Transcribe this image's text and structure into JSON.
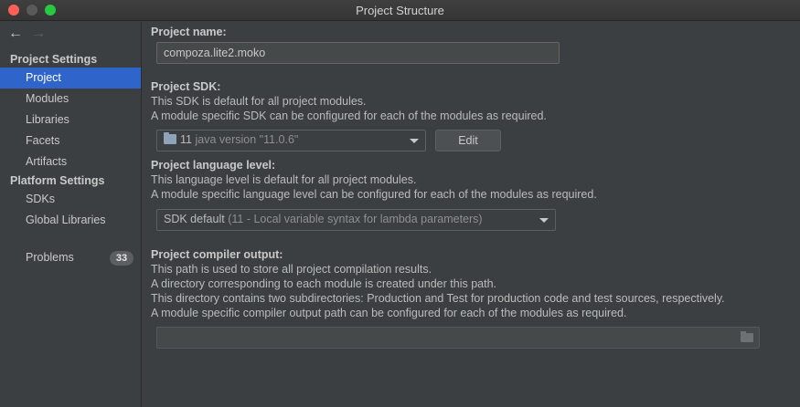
{
  "window": {
    "title": "Project Structure"
  },
  "sidebar": {
    "back_glyph": "←",
    "forward_glyph": "→",
    "project_settings_header": "Project Settings",
    "project_items": [
      {
        "label": "Project",
        "selected": true
      },
      {
        "label": "Modules"
      },
      {
        "label": "Libraries"
      },
      {
        "label": "Facets"
      },
      {
        "label": "Artifacts"
      }
    ],
    "platform_settings_header": "Platform Settings",
    "platform_items": [
      {
        "label": "SDKs"
      },
      {
        "label": "Global Libraries"
      }
    ],
    "problems": {
      "label": "Problems",
      "count": "33"
    }
  },
  "project_name": {
    "heading": "Project name:",
    "value": "compoza.lite2.moko"
  },
  "project_sdk": {
    "heading": "Project SDK:",
    "desc1": "This SDK is default for all project modules.",
    "desc2": "A module specific SDK can be configured for each of the modules as required.",
    "sdk_name": "11",
    "sdk_version": "java version \"11.0.6\"",
    "edit_label": "Edit"
  },
  "language_level": {
    "heading": "Project language level:",
    "desc1": "This language level is default for all project modules.",
    "desc2": "A module specific language level can be configured for each of the modules as required.",
    "selected_main": "SDK default",
    "selected_detail": "(11 - Local variable syntax for lambda parameters)"
  },
  "compiler_output": {
    "heading": "Project compiler output:",
    "desc1": "This path is used to store all project compilation results.",
    "desc2": "A directory corresponding to each module is created under this path.",
    "desc3": "This directory contains two subdirectories: Production and Test for production code and test sources, respectively.",
    "desc4": "A module specific compiler output path can be configured for each of the modules as required.",
    "path_value": ""
  },
  "colors": {
    "accent_selection": "#2f65ca",
    "background": "#3c3f41",
    "close": "#fe5f57",
    "maximize": "#28c840"
  }
}
